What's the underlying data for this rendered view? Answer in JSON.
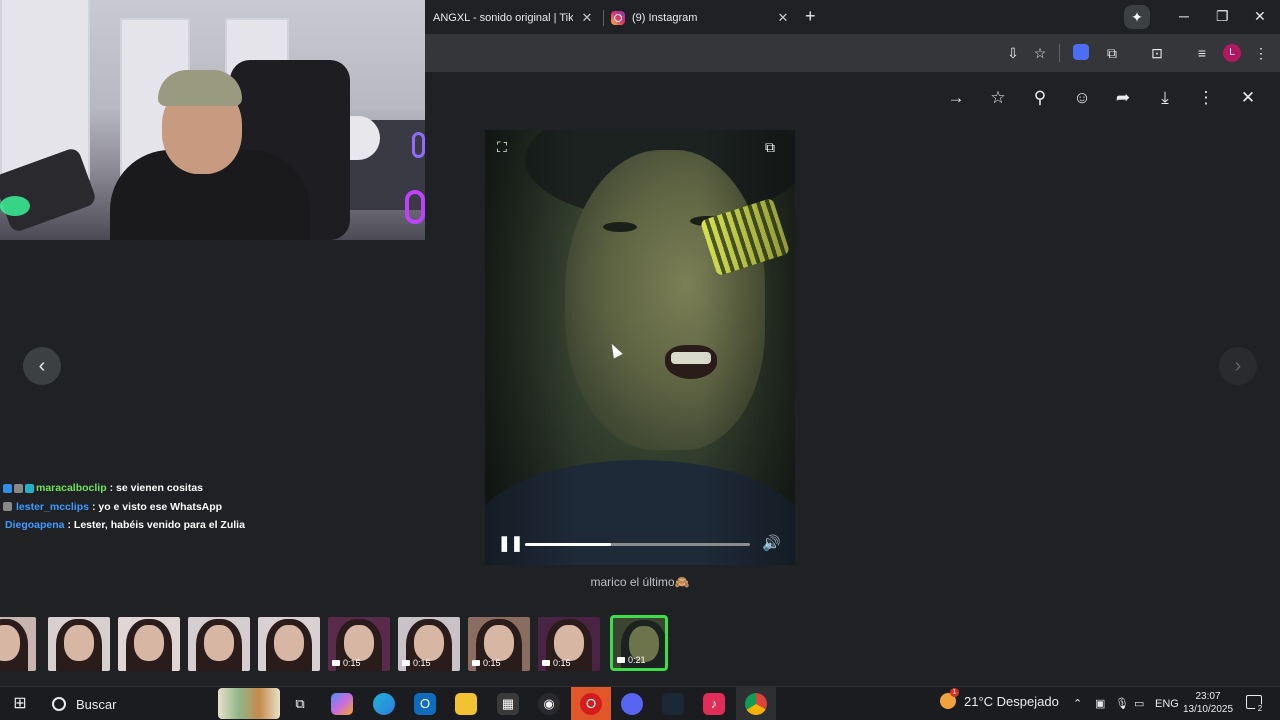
{
  "browser": {
    "tabs": [
      {
        "title": "ANGXL - sonido original | TikTok",
        "active": false
      },
      {
        "title": "(9) Instagram",
        "active": true
      }
    ],
    "new_tab_icon": "plus-icon",
    "window_controls": [
      "minimize",
      "restore",
      "close"
    ],
    "profile_initial": "L",
    "accent": "#b3175f"
  },
  "chat": {
    "messages": [
      {
        "user": "maracalboclip",
        "text": ": se vienen cositas",
        "user_color": "#6de35b"
      },
      {
        "user": "lester_mcclips",
        "text": ": yo e visto ese WhatsApp",
        "user_color": "#3d9bff"
      },
      {
        "user": "Diegoapena",
        "text": ": Lester, habéis venido para el Zulia",
        "user_color": "#3d9bff"
      }
    ]
  },
  "viewer": {
    "caption": "marico el último🙈",
    "progress_fraction": 0.38,
    "icons": [
      "arrow-right-icon",
      "star-icon",
      "pin-icon",
      "emoji-icon",
      "share-icon",
      "download-icon",
      "more-icon",
      "close-icon"
    ]
  },
  "thumbnails": [
    {
      "duration": ""
    },
    {
      "duration": ""
    },
    {
      "duration": ""
    },
    {
      "duration": ""
    },
    {
      "duration": ""
    },
    {
      "duration": "0:15"
    },
    {
      "duration": "0:15"
    },
    {
      "duration": "0:15"
    },
    {
      "duration": "0:15"
    },
    {
      "duration": "0:21",
      "selected": true
    }
  ],
  "taskbar": {
    "search_label": "Buscar",
    "weather": "21°C  Despejado",
    "weather_badge": "1",
    "language": "ENG",
    "time": "23:07",
    "date": "13/10/2025",
    "notification_count": "2"
  }
}
